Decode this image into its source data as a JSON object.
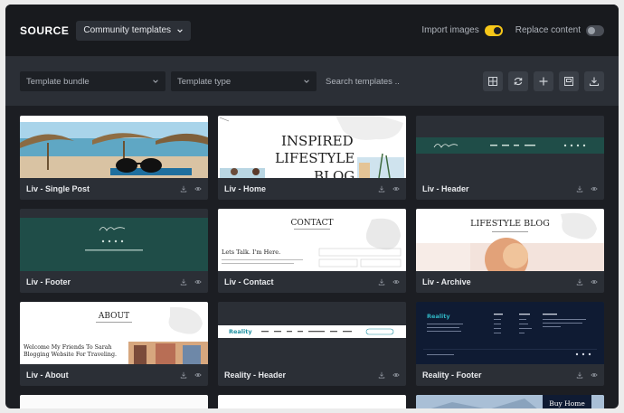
{
  "header": {
    "brand": "SOURCE",
    "source_select": "Community templates",
    "import_images_label": "Import images",
    "import_images_on": true,
    "replace_content_label": "Replace content",
    "replace_content_on": false
  },
  "filters": {
    "bundle_placeholder": "Template bundle",
    "type_placeholder": "Template type",
    "search_placeholder": "Search templates ..",
    "tool_icons": [
      "grid-icon",
      "refresh-icon",
      "plus-icon",
      "save-icon",
      "download-icon"
    ]
  },
  "thumb_text": {
    "single_post": "",
    "home_title_1": "INSPIRED",
    "home_title_2": "LIFESTYLE",
    "home_title_3": "BLOG",
    "contact_title": "CONTACT",
    "contact_sub": "Lets Talk. I'm Here.",
    "archive_title": "LIFESTYLE BLOG",
    "about_title": "ABOUT",
    "about_sub_1": "Welcome My Friends To Sarah",
    "about_sub_2": "Blogging Website For Traveling.",
    "reality_logo": "Reality",
    "buy_home": "Buy Home"
  },
  "cards": [
    {
      "label": "Liv - Single Post"
    },
    {
      "label": "Liv - Home"
    },
    {
      "label": "Liv - Header"
    },
    {
      "label": "Liv - Footer"
    },
    {
      "label": "Liv - Contact"
    },
    {
      "label": "Liv - Archive"
    },
    {
      "label": "Liv - About"
    },
    {
      "label": "Reality - Header"
    },
    {
      "label": "Reality - Footer"
    }
  ],
  "colors": {
    "accent": "#f6c719",
    "panel": "#1c1e23",
    "card": "#2b2f36",
    "liv_green": "#1f4d48",
    "reality_navy": "#0f1b33"
  }
}
